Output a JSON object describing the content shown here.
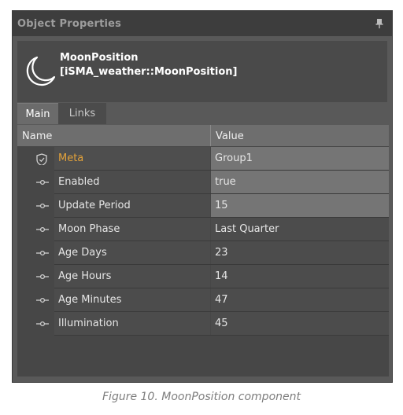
{
  "panel": {
    "title": "Object Properties",
    "pin_icon": "pin-icon"
  },
  "object": {
    "icon": "moon-icon",
    "name": "MoonPosition",
    "type": "[iSMA_weather::MoonPosition]"
  },
  "tabs": [
    {
      "label": "Main",
      "active": true
    },
    {
      "label": "Links",
      "active": false
    }
  ],
  "grid": {
    "columns": [
      "Name",
      "Value"
    ],
    "rows": [
      {
        "icon": "shield-icon",
        "name": "Meta",
        "value": "Group1"
      },
      {
        "icon": "slot-icon",
        "name": "Enabled",
        "value": "true"
      },
      {
        "icon": "slot-icon",
        "name": "Update Period",
        "value": "15"
      },
      {
        "icon": "slot-icon",
        "name": "Moon Phase",
        "value": "Last Quarter"
      },
      {
        "icon": "slot-icon",
        "name": "Age Days",
        "value": "23"
      },
      {
        "icon": "slot-icon",
        "name": "Age Hours",
        "value": "14"
      },
      {
        "icon": "slot-icon",
        "name": "Age Minutes",
        "value": "47"
      },
      {
        "icon": "slot-icon",
        "name": "Illumination",
        "value": "45"
      }
    ]
  },
  "caption": "Figure 10. MoonPosition component",
  "colors": {
    "panel_bg": "#595959",
    "title_bar": "#3d3d3d",
    "meta_accent": "#e3a23a",
    "editable_value_bg": "#757575"
  }
}
